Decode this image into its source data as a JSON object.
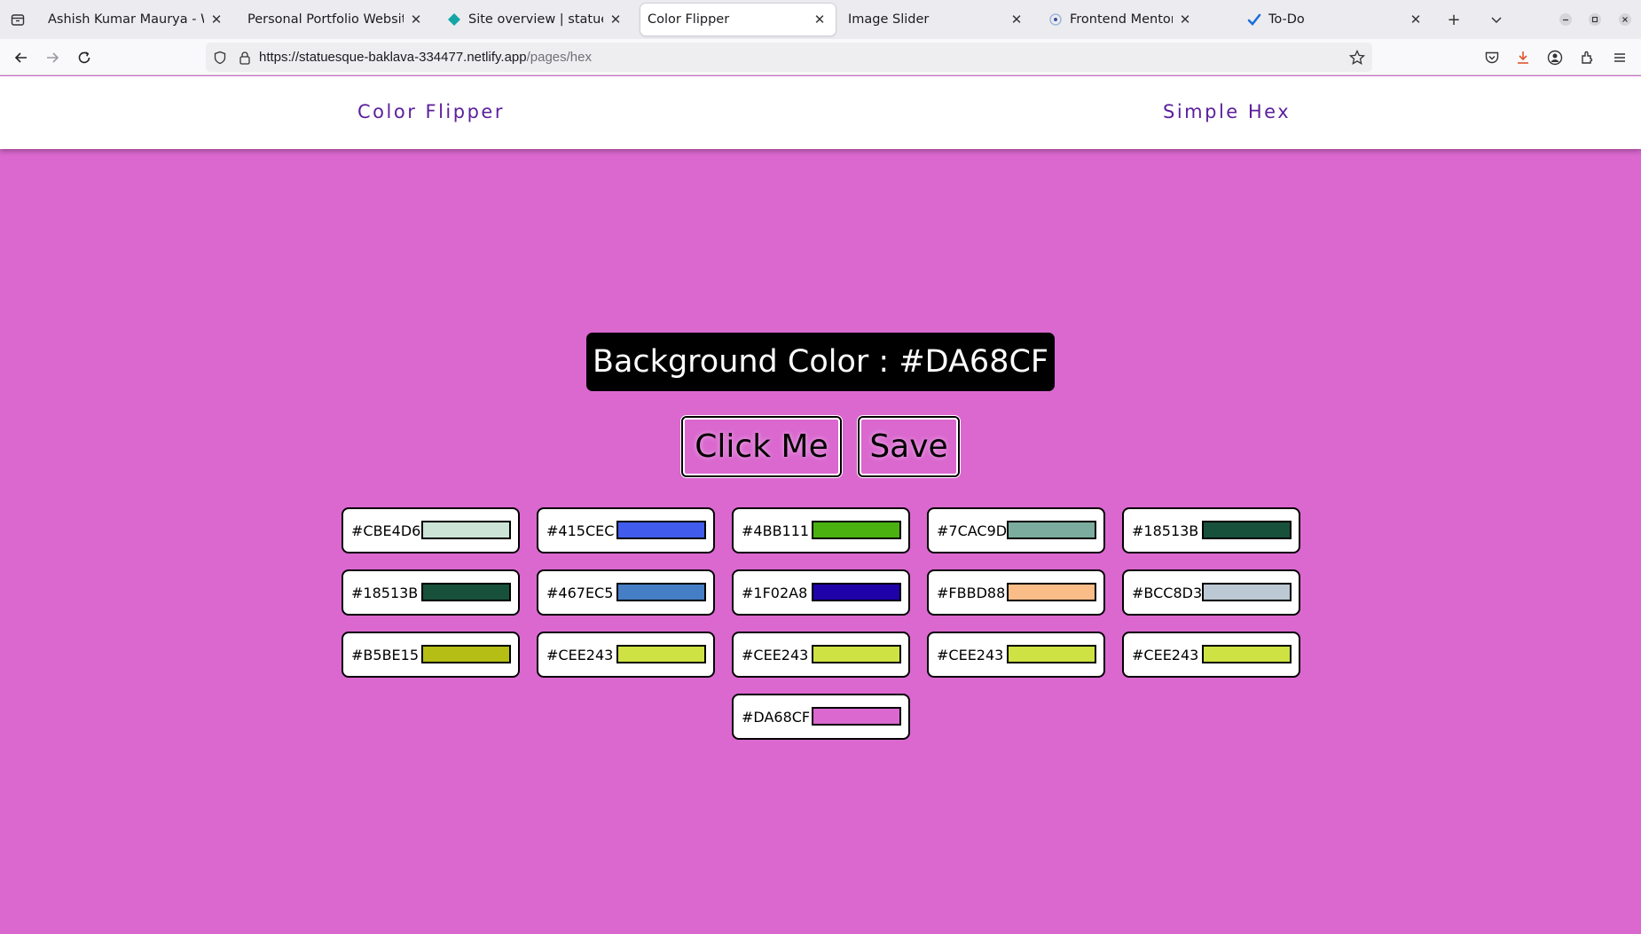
{
  "browser": {
    "tabs": [
      {
        "title": "Ashish Kumar Maurya - Web",
        "active": false,
        "favicon": "none"
      },
      {
        "title": "Personal Portfolio Website",
        "active": false,
        "favicon": "none"
      },
      {
        "title": "Site overview | statuesqu",
        "active": false,
        "favicon": "netlify-icon"
      },
      {
        "title": "Color Flipper",
        "active": true,
        "favicon": "none"
      },
      {
        "title": "Image Slider",
        "active": false,
        "favicon": "none"
      },
      {
        "title": "Frontend Mentor | QR co",
        "active": false,
        "favicon": "frontend-mentor-icon"
      },
      {
        "title": "To-Do",
        "active": false,
        "favicon": "checkmark-icon"
      }
    ],
    "url": {
      "host": "https://statuesque-baklava-334477.netlify.app",
      "path": "/pages/hex"
    }
  },
  "header": {
    "brand": "Color Flipper",
    "nav_link": "Simple Hex"
  },
  "main": {
    "background_label": "Background Color : #DA68CF",
    "background_color": "#DA68CF",
    "click_button": "Click Me",
    "save_button": "Save"
  },
  "swatches": [
    {
      "hex": "#CBE4D6",
      "color": "#CBE4D6"
    },
    {
      "hex": "#415CEC",
      "color": "#415CEC"
    },
    {
      "hex": "#4BB111",
      "color": "#4BB111"
    },
    {
      "hex": "#7CAC9D",
      "color": "#7CAC9D"
    },
    {
      "hex": "#18513B",
      "color": "#18513B"
    },
    {
      "hex": "#18513B",
      "color": "#18513B"
    },
    {
      "hex": "#467EC5",
      "color": "#467EC5"
    },
    {
      "hex": "#1F02A8",
      "color": "#1F02A8"
    },
    {
      "hex": "#FBBD88",
      "color": "#FBBD88"
    },
    {
      "hex": "#BCC8D3",
      "color": "#BCC8D3"
    },
    {
      "hex": "#B5BE15",
      "color": "#B5BE15"
    },
    {
      "hex": "#CEE243",
      "color": "#CEE243"
    },
    {
      "hex": "#CEE243",
      "color": "#CEE243"
    },
    {
      "hex": "#CEE243",
      "color": "#CEE243"
    },
    {
      "hex": "#CEE243",
      "color": "#CEE243"
    },
    {
      "hex": "#DA68CF",
      "color": "#DA68CF"
    }
  ]
}
